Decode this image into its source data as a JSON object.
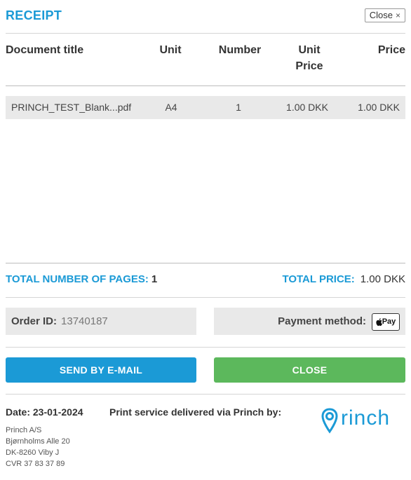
{
  "header": {
    "title": "RECEIPT",
    "close_label": "Close",
    "close_glyph": "×"
  },
  "table": {
    "columns": [
      "Document title",
      "Unit",
      "Number",
      "Unit Price",
      "Price"
    ],
    "unit_price_lines": [
      "Unit",
      "Price"
    ],
    "rows": [
      {
        "title": "PRINCH_TEST_Blank...pdf",
        "unit": "A4",
        "number": "1",
        "unit_price": "1.00 DKK",
        "price": "1.00 DKK"
      }
    ]
  },
  "totals": {
    "pages_label": "TOTAL NUMBER OF PAGES:",
    "pages_value": "1",
    "price_label": "TOTAL PRICE:",
    "price_value": "1.00 DKK"
  },
  "order": {
    "id_label": "Order ID:",
    "id_value": "13740187",
    "payment_label": "Payment method:",
    "payment_badge": "Pay",
    "payment_icon": "apple-icon"
  },
  "buttons": {
    "send_email": "SEND BY E-MAIL",
    "close": "CLOSE"
  },
  "footer": {
    "date": "Date: 23-01-2024",
    "delivered_via": "Print service delivered via Princh by:",
    "address": [
      "Princh A/S",
      "Bjørnholms Alle 20",
      "DK-8260 Viby J",
      "CVR 37 83 37 89"
    ],
    "logo_text": "princh"
  },
  "colors": {
    "accent": "#1b9ad6",
    "green": "#5cb85c",
    "row_bg": "#e9e9e9"
  }
}
